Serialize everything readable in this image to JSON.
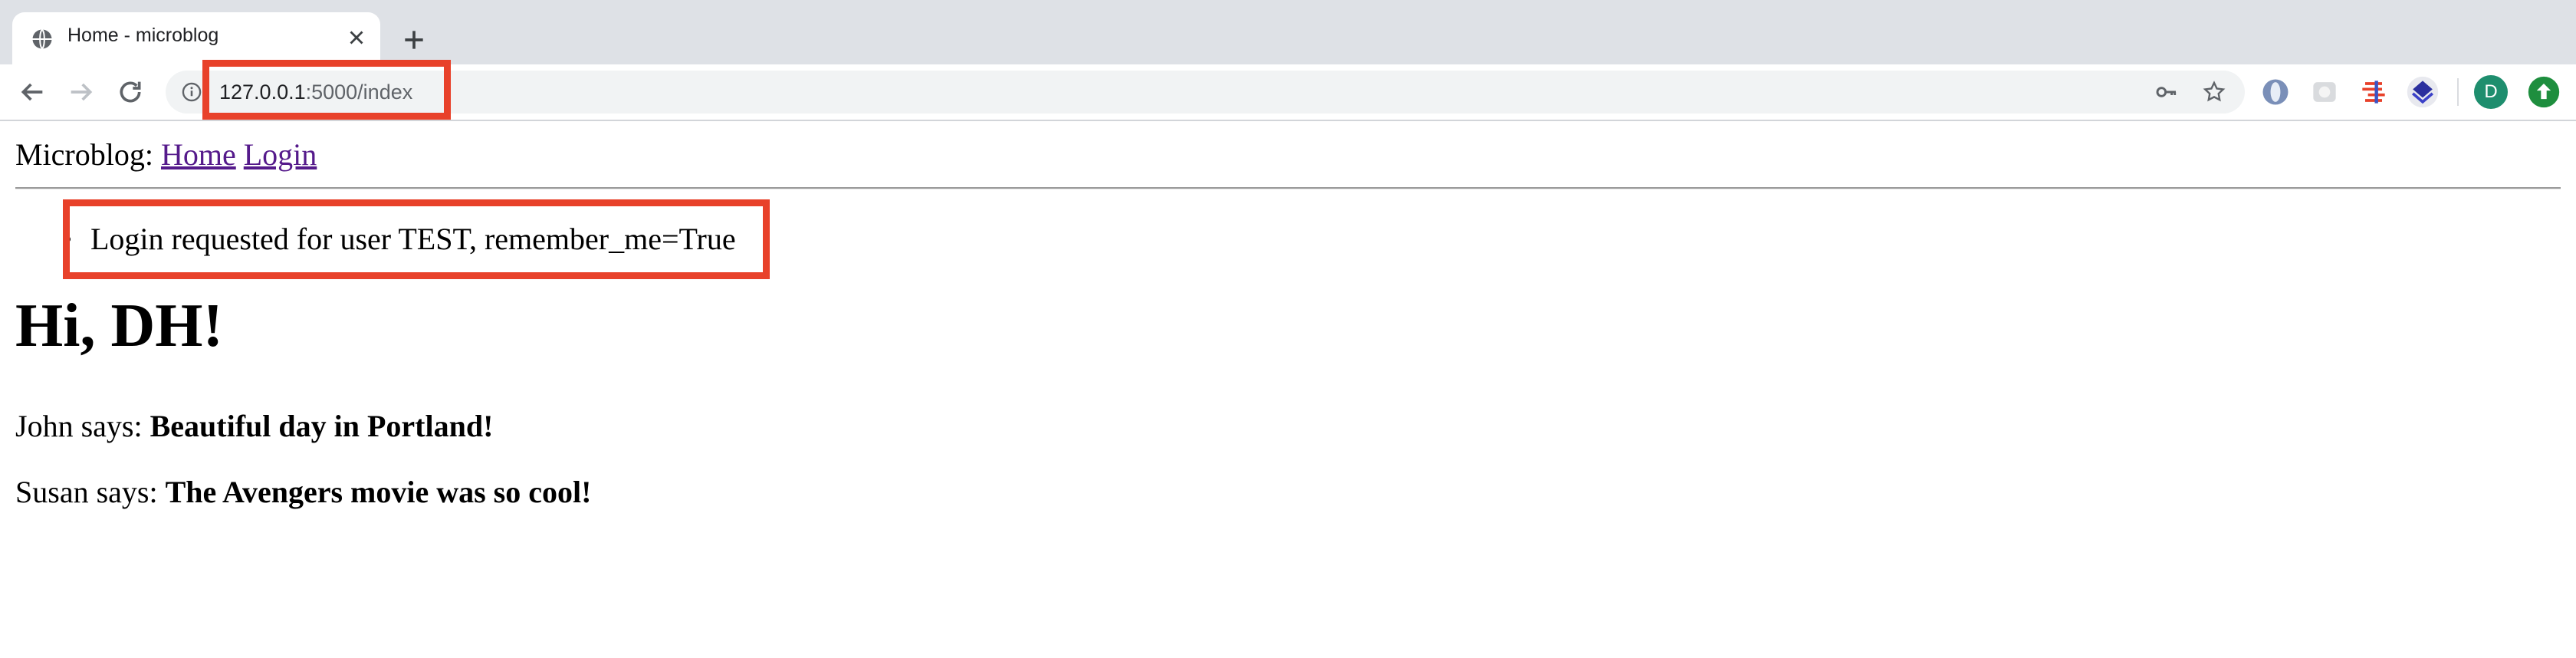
{
  "browser": {
    "tab_title": "Home - microblog",
    "url_host": "127.0.0.1",
    "url_rest": ":5000/index",
    "profile_initial": "D",
    "icons": [
      "back-icon",
      "forward-icon",
      "reload-icon",
      "info-icon",
      "key-icon",
      "star-icon",
      "extension-icons",
      "update-icon"
    ]
  },
  "page": {
    "brand": "Microblog:",
    "nav": {
      "home": "Home",
      "login": "Login"
    },
    "flash_message": "Login requested for user TEST, remember_me=True",
    "heading": "Hi, DH!",
    "posts": [
      {
        "author": "John says:",
        "body": "Beautiful day in Portland!"
      },
      {
        "author": "Susan says:",
        "body": "The Avengers movie was so cool!"
      }
    ]
  },
  "colors": {
    "highlight": "#e8412a",
    "link_visited": "#551a8b",
    "tabstrip": "#dee1e6"
  }
}
